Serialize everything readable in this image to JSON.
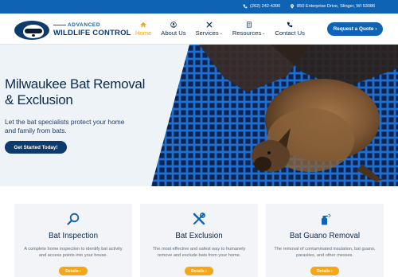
{
  "topbar": {
    "phone": "(262) 242-4390",
    "address": "850 Enterprise Drive, Slinger, WI 53086",
    "phone_icon": "phone-icon",
    "address_icon": "map-pin-icon"
  },
  "logo": {
    "line1": "ADVANCED",
    "line2": "WILDLIFE CONTROL",
    "icon": "raccoon-logo-icon"
  },
  "nav": {
    "items": [
      {
        "label": "Home",
        "icon": "home-icon",
        "active": true,
        "dropdown": false
      },
      {
        "label": "About Us",
        "icon": "user-icon",
        "active": false,
        "dropdown": false
      },
      {
        "label": "Services",
        "icon": "tools-icon",
        "active": false,
        "dropdown": true
      },
      {
        "label": "Resources",
        "icon": "document-icon",
        "active": false,
        "dropdown": true
      },
      {
        "label": "Contact Us",
        "icon": "phone-icon",
        "active": false,
        "dropdown": false
      }
    ],
    "quote_button": "Request a Quote ›"
  },
  "hero": {
    "title": "Milwaukee Bat Removal & Exclusion",
    "subtitle": "Let the bat specialists protect your home and family from bats.",
    "cta": "Get Started Today!",
    "image": "bat-on-screen-photo"
  },
  "services": {
    "cards": [
      {
        "icon": "magnifier-icon",
        "title": "Bat Inspection",
        "description": "A complete home inspection to identify bat activity and access points into your house.",
        "button": "Details ›"
      },
      {
        "icon": "wrench-screwdriver-icon",
        "title": "Bat Exclusion",
        "description": "The most effective and safest way to humanely remove and exclude bats from your home.",
        "button": "Details ›"
      },
      {
        "icon": "spray-bottle-icon",
        "title": "Bat Guano Removal",
        "description": "The removal of contaminated insulation, bat guano, parasites, and other messes.",
        "button": "Details ›"
      }
    ]
  },
  "colors": {
    "primary": "#0e63b5",
    "navy": "#0e3b6e",
    "accent": "#f4a71d",
    "hero_bg": "#eef3f8",
    "card_bg": "#f2f4f7"
  }
}
